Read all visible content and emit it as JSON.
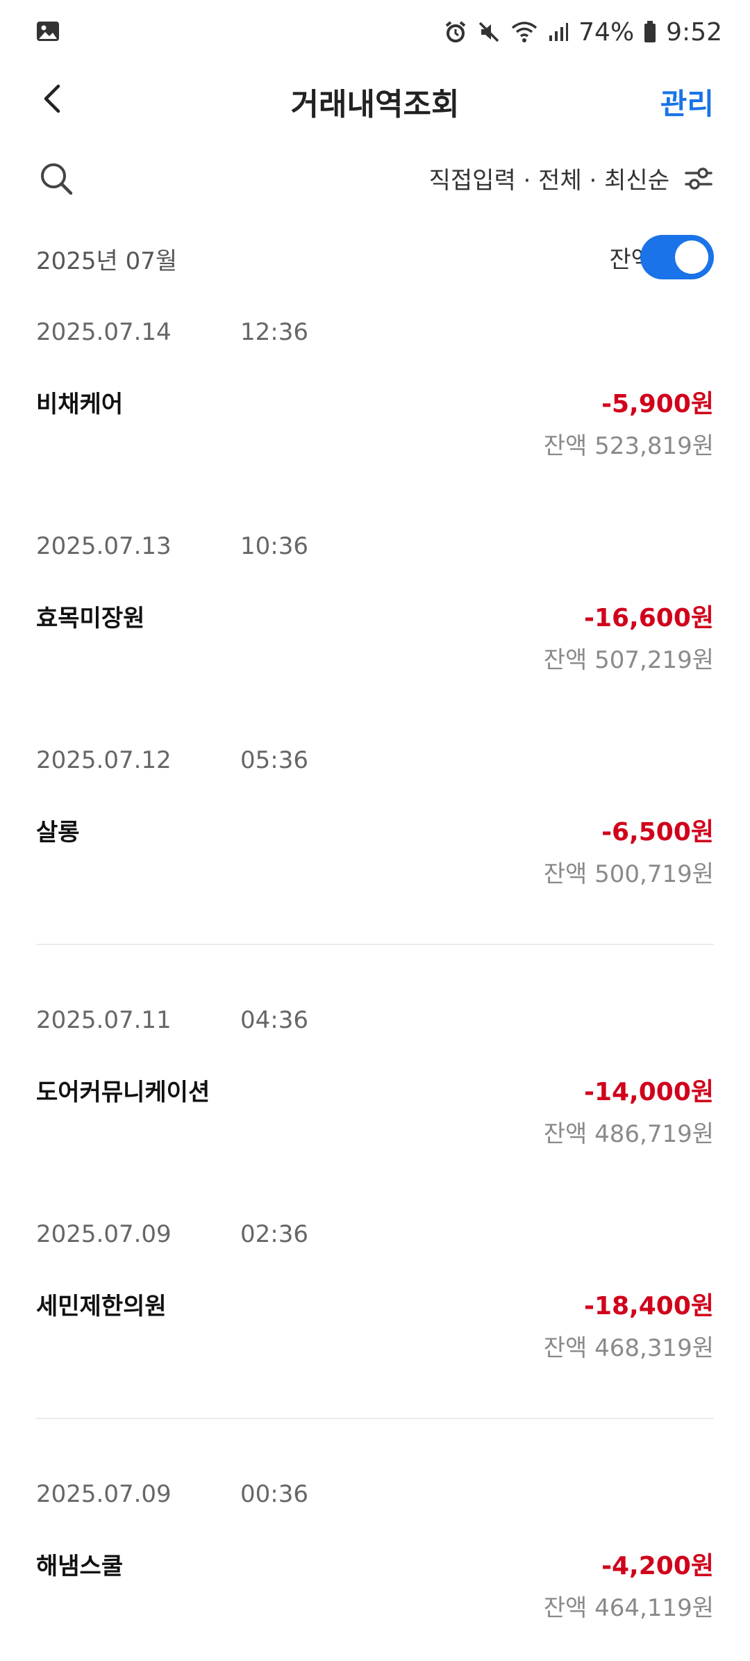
{
  "status_bar": {
    "battery": "74%",
    "time": "9:52"
  },
  "header": {
    "title": "거래내역조회",
    "manage": "관리"
  },
  "toolbar": {
    "filter": "직접입력 · 전체 · 최신순"
  },
  "month": {
    "label": "2025년 07월",
    "balance_toggle_label": "잔액",
    "balance_toggle_on": true
  },
  "colors": {
    "accent": "#1a73e8",
    "negative": "#d0021b"
  },
  "transactions": [
    {
      "date": "2025.07.14",
      "time": "12:36",
      "merchant": "비채케어",
      "amount": "-5,900원",
      "balance": "잔액 523,819원"
    },
    {
      "date": "2025.07.13",
      "time": "10:36",
      "merchant": "효목미장원",
      "amount": "-16,600원",
      "balance": "잔액 507,219원"
    },
    {
      "date": "2025.07.12",
      "time": "05:36",
      "merchant": "살롱",
      "amount": "-6,500원",
      "balance": "잔액 500,719원"
    },
    {
      "date": "2025.07.11",
      "time": "04:36",
      "merchant": "도어커뮤니케이션",
      "amount": "-14,000원",
      "balance": "잔액 486,719원"
    },
    {
      "date": "2025.07.09",
      "time": "02:36",
      "merchant": "세민제한의원",
      "amount": "-18,400원",
      "balance": "잔액 468,319원"
    },
    {
      "date": "2025.07.09",
      "time": "00:36",
      "merchant": "해냄스쿨",
      "amount": "-4,200원",
      "balance": "잔액 464,119원"
    }
  ]
}
